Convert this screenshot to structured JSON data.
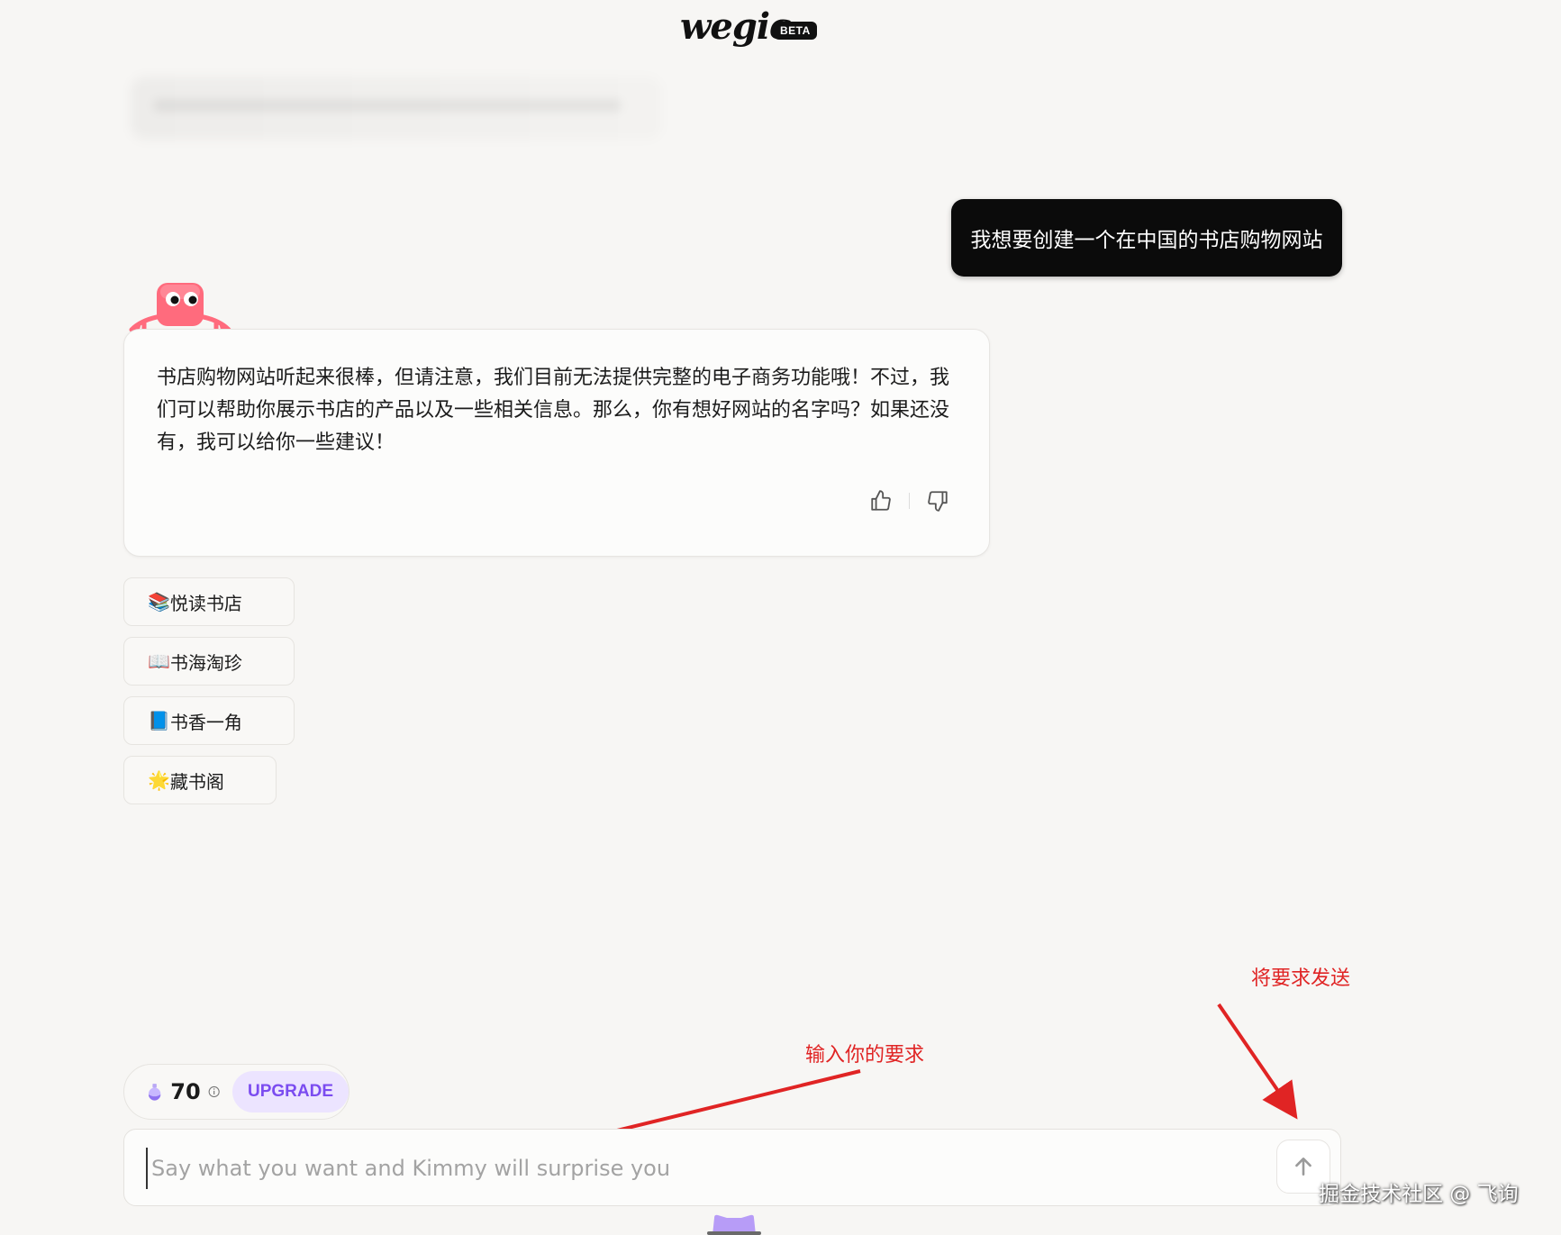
{
  "header": {
    "logo_text": "wegic",
    "beta_badge": "BETA"
  },
  "chat": {
    "user_message": "我想要创建一个在中国的书店购物网站",
    "ai_message": "书店购物网站听起来很棒，但请注意，我们目前无法提供完整的电子商务功能哦！不过，我们可以帮助你展示书店的产品以及一些相关信息。那么，你有想好网站的名字吗？如果还没有，我可以给你一些建议！",
    "feedback": {
      "like_icon": "thumbs-up-icon",
      "dislike_icon": "thumbs-down-icon"
    },
    "suggestions": [
      {
        "emoji": "📚",
        "label": "悦读书店"
      },
      {
        "emoji": "📖",
        "label": "书海淘珍"
      },
      {
        "emoji": "📘",
        "label": "书香一角"
      },
      {
        "emoji": "🌟",
        "label": "藏书阁"
      }
    ]
  },
  "credits": {
    "count": "70",
    "upgrade_label": "UPGRADE",
    "icon": "potion-icon"
  },
  "input": {
    "placeholder": "Say what you want and Kimmy will surprise you",
    "send_icon": "arrow-up-icon"
  },
  "annotations": {
    "send_hint": "将要求发送",
    "input_hint": "输入你的要求"
  },
  "watermark": "掘金技术社区 @ 飞询",
  "colors": {
    "accent": "#7b4cf0",
    "annotation": "#e02424",
    "user_bubble": "#0b0b0b",
    "mascot": "#ff6b7d"
  }
}
